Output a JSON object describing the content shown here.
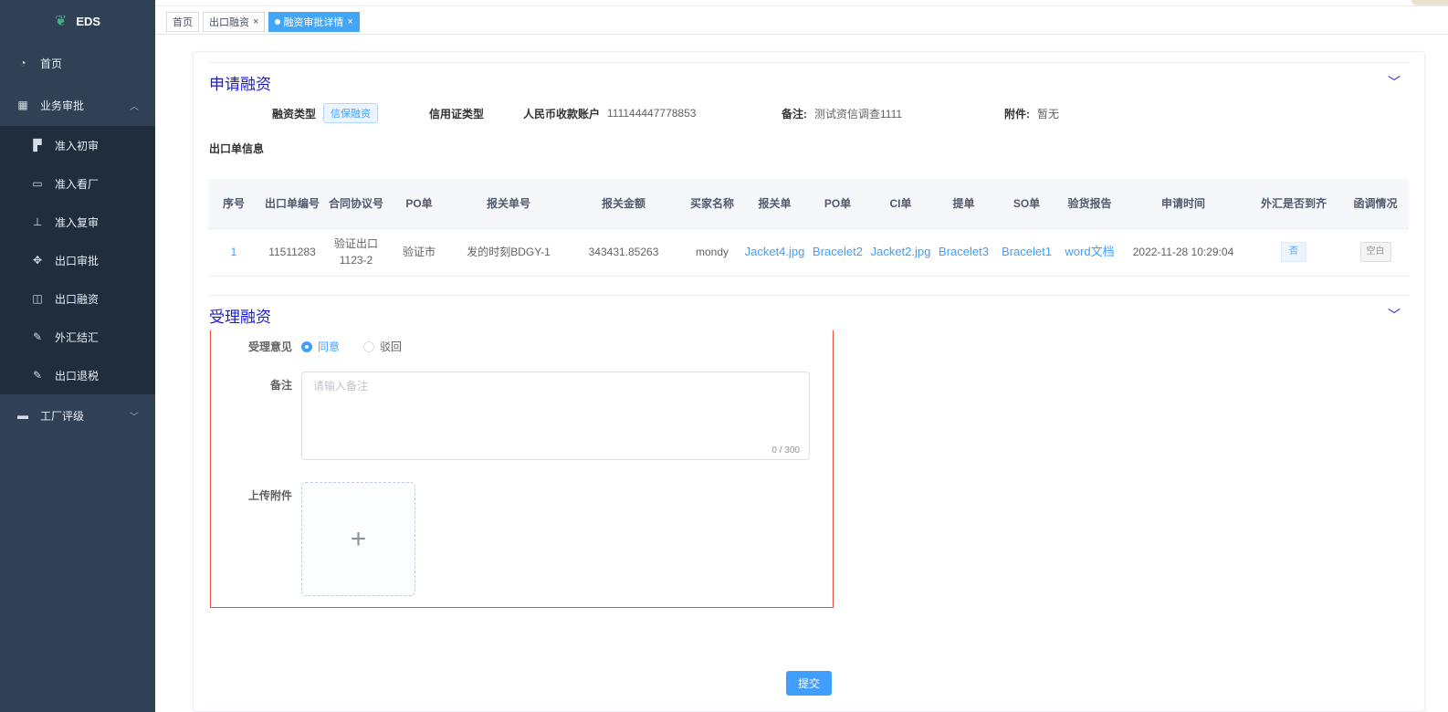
{
  "app": {
    "logo_text": "EDS"
  },
  "sidebar": {
    "items": [
      {
        "label": "首页",
        "icon": "dashboard-icon"
      },
      {
        "label": "业务审批",
        "icon": "table-icon",
        "expanded": true
      },
      {
        "label": "工厂评级",
        "icon": "rating-icon"
      }
    ],
    "subitems": [
      {
        "label": "准入初审",
        "icon": "doc-icon"
      },
      {
        "label": "准入看厂",
        "icon": "calendar-icon"
      },
      {
        "label": "准入复审",
        "icon": "stamp-icon"
      },
      {
        "label": "出口审批",
        "icon": "move-icon"
      },
      {
        "label": "出口融资",
        "icon": "board-icon"
      },
      {
        "label": "外汇结汇",
        "icon": "edit-icon"
      },
      {
        "label": "出口退税",
        "icon": "edit-icon"
      }
    ]
  },
  "tabs": [
    {
      "label": "首页"
    },
    {
      "label": "出口融资"
    },
    {
      "label": "融资审批详情"
    }
  ],
  "apply_section": {
    "title": "申请融资",
    "financing_type_label": "融资类型",
    "financing_type_value": "信保融资",
    "lc_type_label": "信用证类型",
    "rmb_account_label": "人民币收款账户",
    "rmb_account_value": "111144447778853",
    "remark_label": "备注:",
    "remark_value": "测试资信调查1111",
    "attachment_label": "附件:",
    "attachment_value": "暂无",
    "sub_title": "出口单信息"
  },
  "table": {
    "headers": [
      "序号",
      "出口单编号",
      "合同协议号",
      "PO单",
      "报关单号",
      "报关金额",
      "买家名称",
      "报关单",
      "PO单",
      "CI单",
      "提单",
      "SO单",
      "验货报告",
      "申请时间",
      "外汇是否到齐",
      "函调情况"
    ],
    "rows": [
      {
        "index": "1",
        "export_no": "11511283",
        "contract_no": "验证出口1123-2",
        "po": "验证市",
        "customs_no": "发的时刻BDGY-1",
        "amount": "343431.85263",
        "buyer": "mondy",
        "customs_file": "Jacket4.jpg",
        "po_file": "Bracelet2",
        "ci_file": "Jacket2.jpg",
        "bl_file": "Bracelet3",
        "so_file": "Bracelet1",
        "inspection_file": "word文档",
        "apply_time": "2022-11-28 10:29:04",
        "fx_complete": "否",
        "letter_status": "空白"
      }
    ]
  },
  "accept_section": {
    "title": "受理融资",
    "opinion_label": "受理意见",
    "opinion_options": [
      "同意",
      "驳回"
    ],
    "opinion_selected": "同意",
    "remark_label": "备注",
    "remark_placeholder": "请输入备注",
    "remark_counter": "0 / 300",
    "upload_label": "上传附件",
    "submit_label": "提交"
  },
  "colors": {
    "sidebar_bg": "#304156",
    "accent": "#409eff",
    "section_title": "#1a1ad6",
    "form_border": "#e74c3c"
  }
}
